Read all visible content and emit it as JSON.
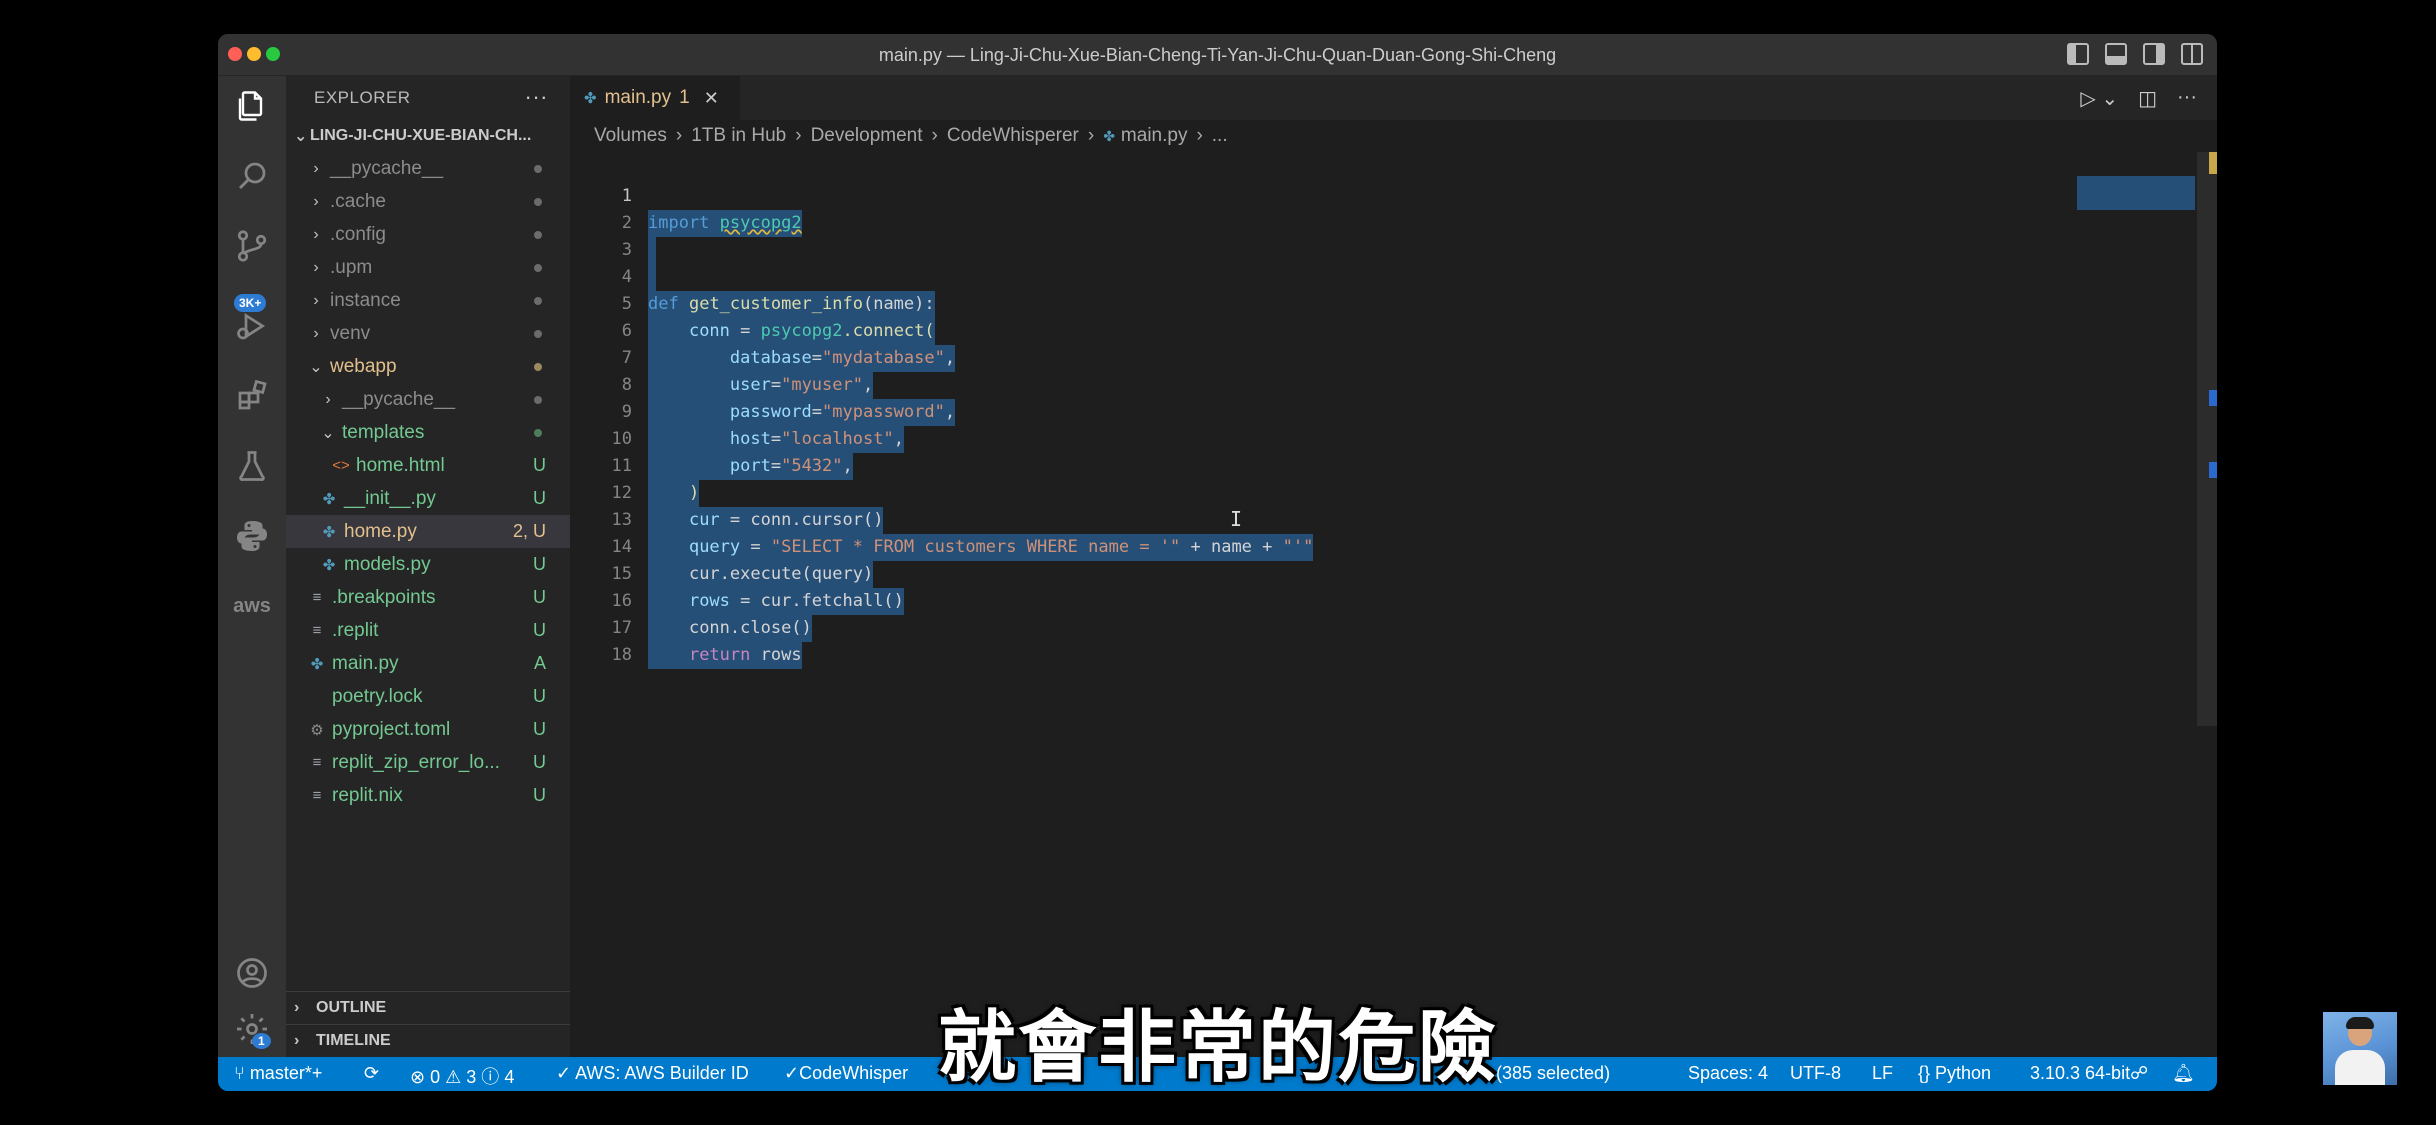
{
  "window": {
    "title": "main.py — Ling-Ji-Chu-Xue-Bian-Cheng-Ti-Yan-Ji-Chu-Quan-Duan-Gong-Shi-Cheng"
  },
  "activity_bar": {
    "source_control_badge": "3K+",
    "settings_badge": "1",
    "aws_label": "aws"
  },
  "explorer": {
    "header": "EXPLORER",
    "more": "···",
    "project": "LING-JI-CHU-XUE-BIAN-CH...",
    "items": [
      {
        "label": "__pycache__",
        "chev": "›",
        "icon": "",
        "status": ""
      },
      {
        "label": ".cache",
        "chev": "›",
        "icon": "",
        "status": ""
      },
      {
        "label": ".config",
        "chev": "›",
        "icon": "",
        "status": ""
      },
      {
        "label": ".upm",
        "chev": "›",
        "icon": "",
        "status": ""
      },
      {
        "label": "instance",
        "chev": "›",
        "icon": "",
        "status": ""
      },
      {
        "label": "venv",
        "chev": "›",
        "icon": "",
        "status": ""
      },
      {
        "label": "webapp",
        "chev": "⌄",
        "icon": "",
        "status": ""
      },
      {
        "label": "__pycache__",
        "chev": "›",
        "icon": "",
        "status": ""
      },
      {
        "label": "templates",
        "chev": "⌄",
        "icon": "",
        "status": ""
      },
      {
        "label": "home.html",
        "chev": "",
        "icon": "<>",
        "status": "U"
      },
      {
        "label": "__init__.py",
        "chev": "",
        "icon": "✤",
        "status": "U"
      },
      {
        "label": "home.py",
        "chev": "",
        "icon": "✤",
        "status": "2, U"
      },
      {
        "label": "models.py",
        "chev": "",
        "icon": "✤",
        "status": "U"
      },
      {
        "label": ".breakpoints",
        "chev": "",
        "icon": "≡",
        "status": "U"
      },
      {
        "label": ".replit",
        "chev": "",
        "icon": "≡",
        "status": "U"
      },
      {
        "label": "main.py",
        "chev": "",
        "icon": "✤",
        "status": "A"
      },
      {
        "label": "poetry.lock",
        "chev": "",
        "icon": "",
        "status": "U"
      },
      {
        "label": "pyproject.toml",
        "chev": "",
        "icon": "⚙",
        "status": "U"
      },
      {
        "label": "replit_zip_error_lo...",
        "chev": "",
        "icon": "≡",
        "status": "U"
      },
      {
        "label": "replit.nix",
        "chev": "",
        "icon": "≡",
        "status": "U"
      }
    ],
    "outline": "OUTLINE",
    "timeline": "TIMELINE"
  },
  "tab": {
    "label": "main.py",
    "problems": "1",
    "close": "✕"
  },
  "breadcrumb": [
    "Volumes",
    "1TB in Hub",
    "Development",
    "CodeWhisperer",
    "main.py",
    "..."
  ],
  "code": {
    "line_numbers": [
      "1",
      "2",
      "3",
      "4",
      "5",
      "6",
      "7",
      "8",
      "9",
      "10",
      "11",
      "12",
      "13",
      "14",
      "15",
      "16",
      "17",
      "18"
    ],
    "l1_kw": "import",
    "l1_mod": "psycopg2",
    "l4_kw": "def",
    "l4_fn": "get_customer_info",
    "l4_rest": "(name):",
    "l5_var": "conn",
    "l5_eq": " = ",
    "l5_mod": "psycopg2",
    "l5_fn": ".connect(",
    "l6_key": "database",
    "l6_val": "\"mydatabase\"",
    "l7_key": "user",
    "l7_val": "\"myuser\"",
    "l8_key": "password",
    "l8_val": "\"mypassword\"",
    "l9_key": "host",
    "l9_val": "\"localhost\"",
    "l10_key": "port",
    "l10_val": "\"5432\"",
    "l11": ")",
    "l12_var": "cur",
    "l12_rest": " = conn.cursor()",
    "l13_var": "query",
    "l13_eq": " = ",
    "l13_str1": "\"SELECT * FROM customers WHERE name = '\"",
    "l13_mid": " + name + ",
    "l13_str2": "\"'\"",
    "l14": "cur.execute(query)",
    "l15_var": "rows",
    "l15_rest": " = cur.fetchall()",
    "l16": "conn.close()",
    "l17_kw": "return",
    "l17_rest": " rows"
  },
  "statusbar": {
    "branch": "master*+",
    "sync": "⟳",
    "errors": "0",
    "warnings": "3",
    "infos": "4",
    "aws": "AWS: AWS Builder ID",
    "codewhisperer": "CodeWhisper",
    "selection": "(385 selected)",
    "spaces": "Spaces: 4",
    "encoding": "UTF-8",
    "eol": "LF",
    "language": "Python",
    "interpreter": "3.10.3 64-bit"
  },
  "subtitle": "就會非常的危險",
  "colors": {
    "statusbar": "#007acc",
    "selection": "#264f78",
    "modified_yellow": "#e2c08d",
    "added_green": "#73c991"
  }
}
